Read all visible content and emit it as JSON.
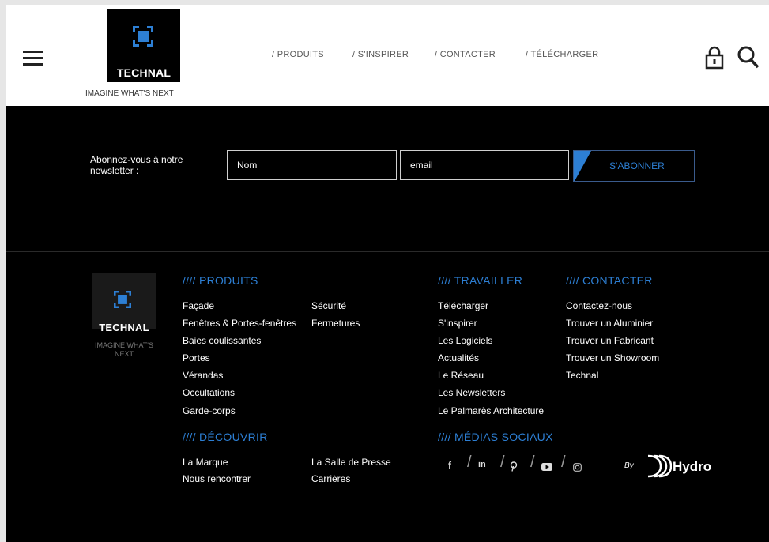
{
  "header": {
    "brand": "TECHNAL",
    "tagline": "IMAGINE WHAT'S NEXT",
    "nav": [
      {
        "label": "/ PRODUITS"
      },
      {
        "label": "/ S'INSPIRER"
      },
      {
        "label": "/ CONTACTER"
      },
      {
        "label": "/ TÉLÉCHARGER"
      }
    ]
  },
  "newsletter": {
    "label": "Abonnez-vous à notre newsletter :",
    "name_placeholder": "Nom",
    "email_placeholder": "email",
    "button_label": "S'ABONNER"
  },
  "footer": {
    "brand": "TECHNAL",
    "tagline": "IMAGINE WHAT'S NEXT",
    "produits": {
      "heading": "//// PRODUITS",
      "col1": [
        "Façade",
        "Fenêtres & Portes-fenêtres",
        "Baies coulissantes",
        "Portes",
        "Vérandas",
        "Occultations",
        "Garde-corps"
      ],
      "col2": [
        "Sécurité",
        "Fermetures"
      ]
    },
    "decouvrir": {
      "heading": "//// DÉCOUVRIR",
      "col1": [
        "La Marque",
        "Nous rencontrer"
      ],
      "col2": [
        "La Salle de Presse",
        "Carrières"
      ]
    },
    "travailler": {
      "heading": "//// TRAVAILLER",
      "items": [
        "Télécharger",
        "S'inspirer",
        "Les Logiciels",
        "Actualités",
        "Le Réseau",
        "Les Newsletters",
        "Le Palmarès Architecture"
      ]
    },
    "contacter": {
      "heading": "//// CONTACTER",
      "items": [
        "Contactez-nous",
        "Trouver un Aluminier",
        "Trouver un Fabricant",
        "Trouver un Showroom",
        "Technal"
      ]
    },
    "medias": {
      "heading": "//// MÉDIAS SOCIAUX",
      "icons": [
        "facebook-icon",
        "linkedin-icon",
        "pinterest-icon",
        "youtube-icon",
        "instagram-icon"
      ],
      "facebook": "f",
      "linkedin": "in"
    },
    "by": "By",
    "hydro": "Hydro"
  },
  "colors": {
    "accent": "#2d7fd4",
    "background": "#000000",
    "header_bg": "#ffffff"
  }
}
